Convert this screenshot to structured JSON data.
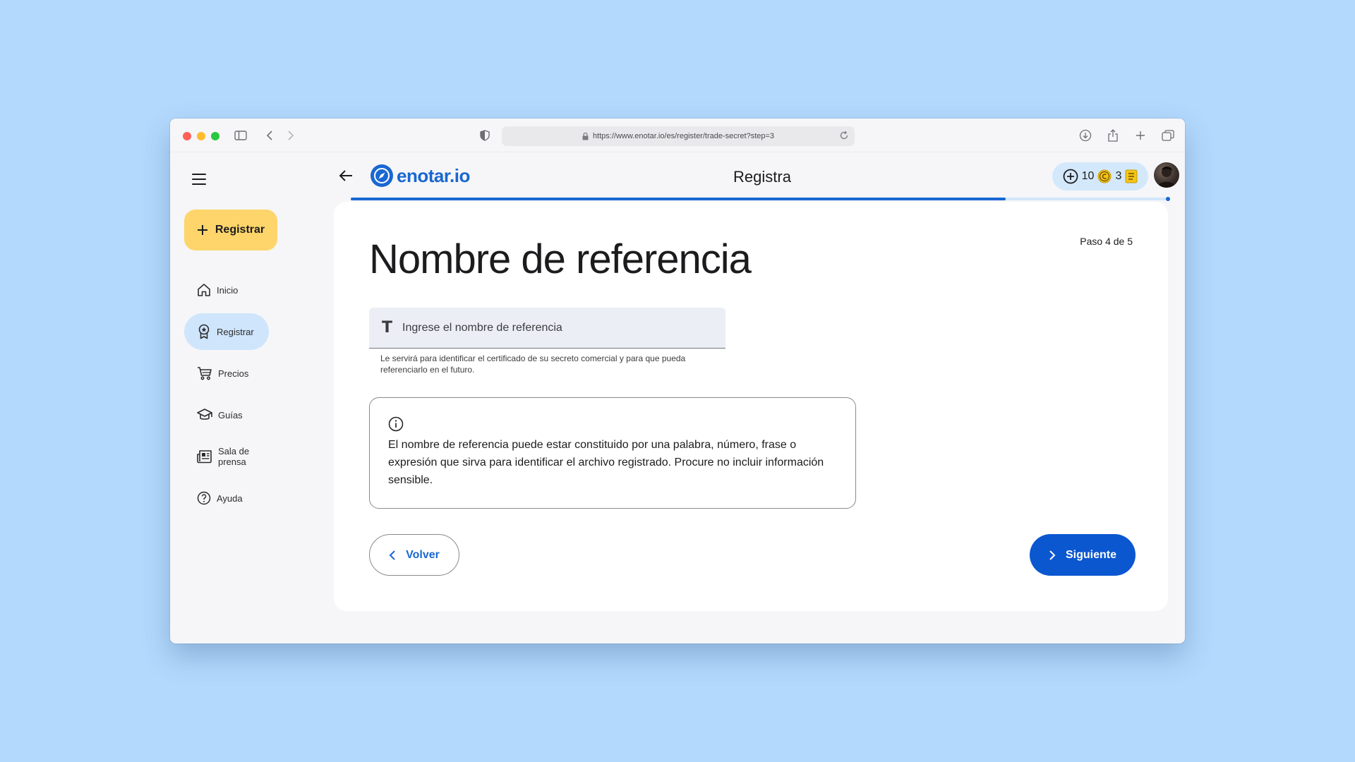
{
  "browser": {
    "url": "https://www.enotar.io/es/register/trade-secret?step=3"
  },
  "sidebar": {
    "register_label": "Registrar",
    "items": [
      {
        "label": "Inicio",
        "icon": "home-icon"
      },
      {
        "label": "Registrar",
        "icon": "award-icon",
        "active": true
      },
      {
        "label": "Precios",
        "icon": "cart-icon"
      },
      {
        "label": "Guías",
        "icon": "graduation-cap-icon"
      },
      {
        "label": "Sala de prensa",
        "icon": "newspaper-icon"
      },
      {
        "label": "Ayuda",
        "icon": "help-icon"
      }
    ]
  },
  "header": {
    "logo_text": "enotar.io",
    "title": "Registra",
    "credits_count": "10",
    "coins_count": "3",
    "progress_fraction": 0.8
  },
  "form": {
    "step_label": "Paso 4 de 5",
    "title": "Nombre de referencia",
    "input_placeholder": "Ingrese el nombre de referencia",
    "input_value": "",
    "helper_text": "Le servirá para identificar el certificado de su secreto comercial y para que pueda referenciarlo en el futuro.",
    "info_text": "El nombre de referencia puede estar constituido por una palabra, número, frase o expresión que sirva para identificar el archivo registrado. Procure no incluir información sensible.",
    "back_label": "Volver",
    "next_label": "Siguiente"
  },
  "colors": {
    "page_bg": "#b3d9fd",
    "accent": "#1967d2",
    "primary_button": "#0b57d0",
    "register_button": "#fdd56a",
    "active_nav": "#cfe5fb"
  }
}
